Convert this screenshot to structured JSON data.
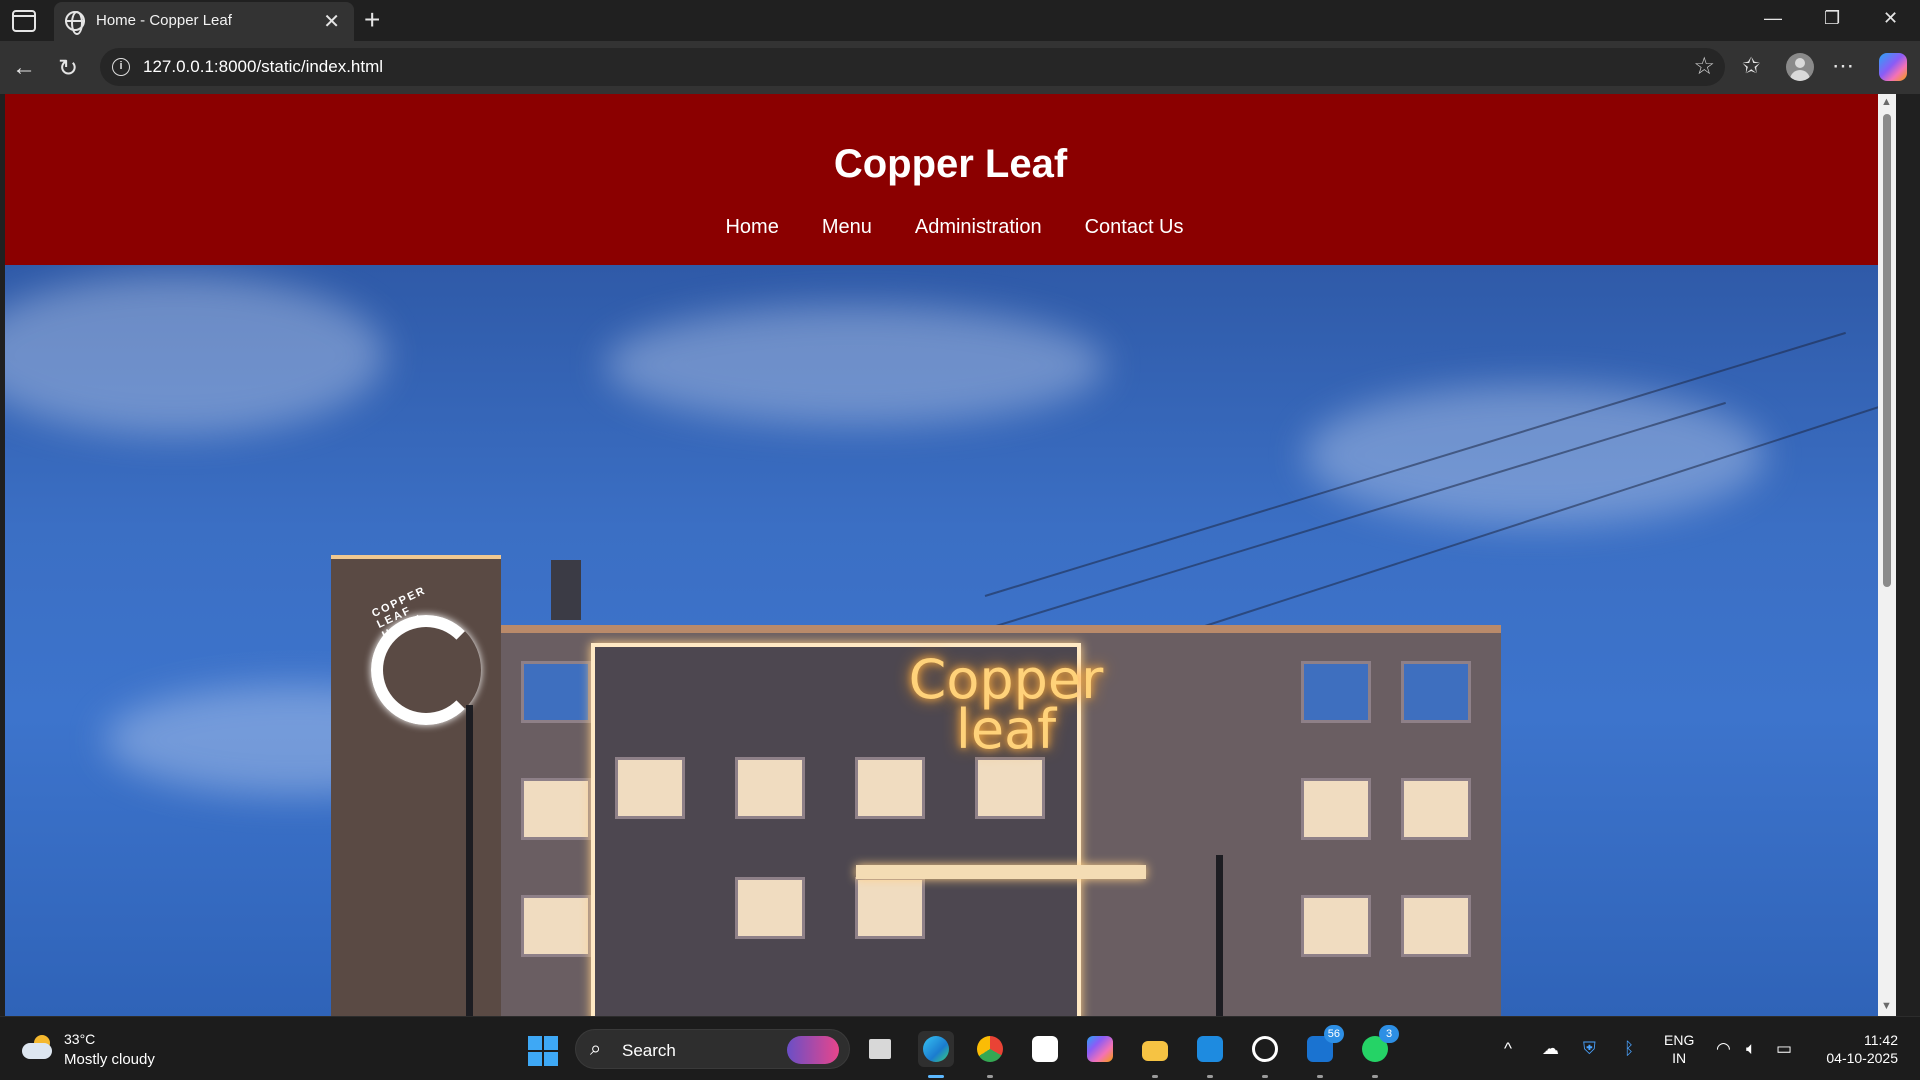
{
  "browser": {
    "tab_title": "Home - Copper Leaf",
    "url": "127.0.0.1:8000/static/index.html"
  },
  "site": {
    "title": "Copper Leaf",
    "nav": [
      "Home",
      "Menu",
      "Administration",
      "Contact Us"
    ],
    "header_color": "#8b0000"
  },
  "hero": {
    "sign_line1": "Copper",
    "sign_line2": "leaf",
    "ring_text": "COPPER LEAF HOTEL"
  },
  "taskbar": {
    "weather_temp": "33°C",
    "weather_desc": "Mostly cloudy",
    "search_label": "Search",
    "badges": {
      "outlook": "56",
      "whatsapp": "3"
    },
    "language": [
      "ENG",
      "IN"
    ],
    "time": "11:42",
    "date": "04-10-2025"
  },
  "icons": [
    "sidebar-toggle-icon",
    "globe-icon",
    "close-icon",
    "plus-icon",
    "minimize-icon",
    "restore-icon",
    "back-icon",
    "refresh-icon",
    "info-icon",
    "star-icon",
    "favorites-icon",
    "profile-icon",
    "more-icon",
    "copilot-icon",
    "windows-start-icon",
    "search-icon"
  ]
}
